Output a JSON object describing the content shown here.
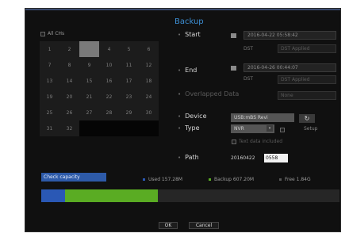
{
  "dialog": {
    "title": "Backup"
  },
  "calendar": {
    "all_channels_label": "All CHs",
    "days": [
      {
        "label": "1",
        "state": "normal"
      },
      {
        "label": "2",
        "state": "normal"
      },
      {
        "label": "3",
        "state": "selected"
      },
      {
        "label": "4",
        "state": "normal"
      },
      {
        "label": "5",
        "state": "normal"
      },
      {
        "label": "6",
        "state": "normal"
      },
      {
        "label": "7",
        "state": "normal"
      },
      {
        "label": "8",
        "state": "normal"
      },
      {
        "label": "9",
        "state": "normal"
      },
      {
        "label": "10",
        "state": "normal"
      },
      {
        "label": "11",
        "state": "normal"
      },
      {
        "label": "12",
        "state": "normal"
      },
      {
        "label": "13",
        "state": "normal"
      },
      {
        "label": "14",
        "state": "normal"
      },
      {
        "label": "15",
        "state": "normal"
      },
      {
        "label": "16",
        "state": "normal"
      },
      {
        "label": "17",
        "state": "normal"
      },
      {
        "label": "18",
        "state": "normal"
      },
      {
        "label": "19",
        "state": "normal"
      },
      {
        "label": "20",
        "state": "normal"
      },
      {
        "label": "21",
        "state": "normal"
      },
      {
        "label": "22",
        "state": "normal"
      },
      {
        "label": "23",
        "state": "normal"
      },
      {
        "label": "24",
        "state": "normal"
      },
      {
        "label": "25",
        "state": "normal"
      },
      {
        "label": "26",
        "state": "normal"
      },
      {
        "label": "27",
        "state": "normal"
      },
      {
        "label": "28",
        "state": "normal"
      },
      {
        "label": "29",
        "state": "normal"
      },
      {
        "label": "30",
        "state": "normal"
      },
      {
        "label": "31",
        "state": "normal"
      },
      {
        "label": "32",
        "state": "normal"
      },
      {
        "label": "",
        "state": "empty"
      },
      {
        "label": "",
        "state": "empty"
      },
      {
        "label": "",
        "state": "empty"
      },
      {
        "label": "",
        "state": "empty"
      }
    ]
  },
  "start": {
    "label": "Start",
    "datetime": "2016-04-22 05:58:42",
    "dst_label": "DST",
    "dst_value": "DST Applied"
  },
  "end": {
    "label": "End",
    "datetime": "2016-04-26 00:44:07",
    "dst_label": "DST",
    "dst_value": "DST Applied"
  },
  "overlapped": {
    "label": "Overlapped Data",
    "value": "None"
  },
  "device": {
    "label": "Device",
    "value": "USB:mBS Revi"
  },
  "type": {
    "label": "Type",
    "value": "NVR",
    "arrow": "▾",
    "player_label": "Setup",
    "text_data_label": "Text data included"
  },
  "path": {
    "label": "Path",
    "prefix": "20160422",
    "value": "0558"
  },
  "capacity": {
    "button_label": "Check capacity",
    "used_label": "Used 157.28M",
    "backup_label": "Backup 607.20M",
    "free_label": "Free 1.84G",
    "used_fraction": 0.0806,
    "backup_fraction": 0.3107,
    "colors": {
      "used": "#2a58b5",
      "backup": "#5aac23",
      "free": "#262626"
    }
  },
  "buttons": {
    "ok": "OK",
    "cancel": "Cancel"
  }
}
